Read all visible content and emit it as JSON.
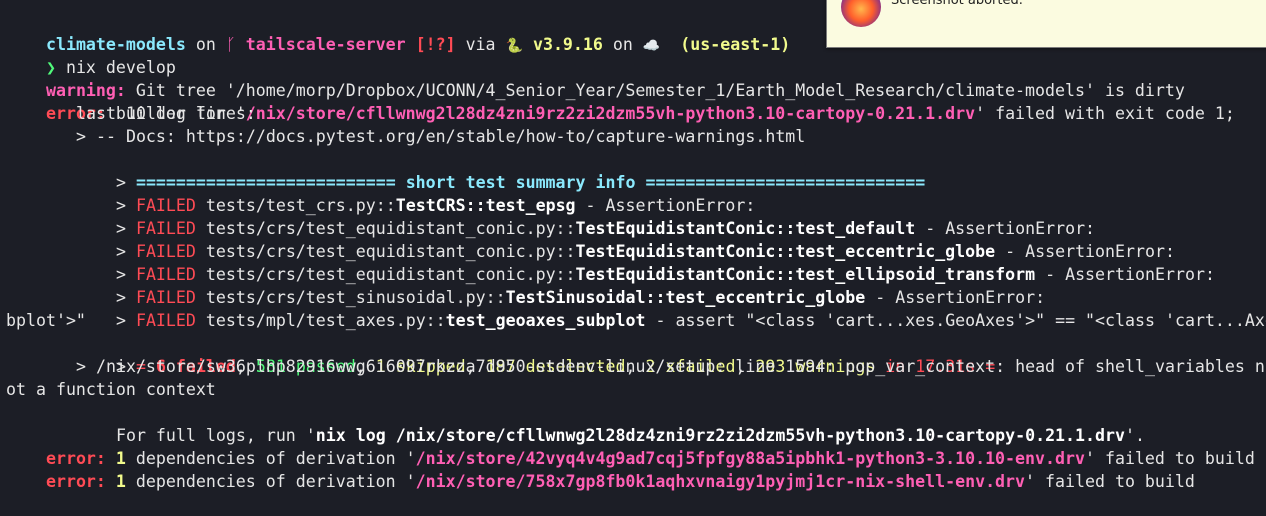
{
  "prompt": {
    "dir": "climate-models",
    "on1": " on ",
    "branch_icon": "ᚴ",
    "branch": " tailscale-server",
    "status": " [!?]",
    "via": " via ",
    "py_icon": "🐍",
    "py": " v3.9.16",
    "on2": " on ",
    "cloud_icon": "☁️",
    "region": "  (us-east-1)"
  },
  "command": {
    "arrow": "❯ ",
    "text": "nix develop"
  },
  "lines": {
    "warn_tag": "warning:",
    "warn_msg": " Git tree '/home/morp/Dropbox/UCONN/4_Senior_Year/Semester_1/Earth_Model_Research/climate-models' is dirty",
    "err1_tag": "error:",
    "err1_a": " builder for '",
    "err1_path": "/nix/store/cfllwnwg2l28dz4zni9rz2zi2dzm55vh-python3.10-cartopy-0.21.1.drv",
    "err1_b": "' failed with exit code 1;",
    "last10": "last 10 log lines:",
    "docs": "> -- Docs: https://docs.pytest.org/en/stable/how-to/capture-warnings.html",
    "summary_gt": "> ",
    "summary": "========================== short test summary info ============================",
    "gt": "> ",
    "failed": "FAILED",
    "f1_path": " tests/test_crs.py::",
    "f1_test": "TestCRS::test_epsg",
    "f1_err": " - AssertionError:",
    "f2_path": " tests/crs/test_equidistant_conic.py::",
    "f2_test": "TestEquidistantConic::test_default",
    "f2_err": " - AssertionError:",
    "f3_path": " tests/crs/test_equidistant_conic.py::",
    "f3_test": "TestEquidistantConic::test_eccentric_globe",
    "f3_err": " - AssertionError:",
    "f4_path": " tests/crs/test_equidistant_conic.py::",
    "f4_test": "TestEquidistantConic::test_ellipsoid_transform",
    "f4_err": " - AssertionError:",
    "f5_path": " tests/crs/test_sinusoidal.py::",
    "f5_test": "TestSinusoidal::test_eccentric_globe",
    "f5_err": " - AssertionError:",
    "f6_path": " tests/mpl/test_axes.py::",
    "f6_test": "test_geoaxes_subplot",
    "f6_err": " - assert \"<class 'cart...xes.GeoAxes'>\" == \"<class 'cart...AxesSu",
    "f6_wrap": "bplot'>\"",
    "res_open": "= ",
    "res_failed": "6 failed",
    "res_c1": ", ",
    "res_passed": "581 passed",
    "res_c2": ", ",
    "res_skipped": "1 skipped",
    "res_c3": ", ",
    "res_deselected": "187 deselected",
    "res_c4": ", ",
    "res_xfailed": "2 xfailed",
    "res_c5": ", ",
    "res_warnings": "293 warnings",
    "res_time": " in 17.31s =",
    "setup": "> /nix/store/sw36plhp82916wwg6i6097rkzza7d950-stdenv-linux/setup: line 1594: pop_var_context: head of shell_variables n",
    "setup_wrap": "ot a function context",
    "full_a": "For full logs, run '",
    "full_cmd": "nix log /nix/store/cfllwnwg2l28dz4zni9rz2zi2dzm55vh-python3.10-cartopy-0.21.1.drv",
    "full_b": "'.",
    "err2_tag": "error:",
    "err2_num": " 1",
    "err2_a": " dependencies of derivation '",
    "err2_path": "/nix/store/42vyq4v4g9ad7cqj5fpfgy88a5ipbhk1-python3-3.10.10-env.drv",
    "err2_b": "' failed to build",
    "err3_tag": "error:",
    "err3_num": " 1",
    "err3_a": " dependencies of derivation '",
    "err3_path": "/nix/store/758x7gp8fb0k1aqhxvnaigy1pyjmj1cr-nix-shell-env.drv",
    "err3_b": "' failed to build"
  },
  "notification": {
    "text": "Screenshot aborted."
  },
  "colors": {
    "background": "#1c1e26",
    "cyan": "#8be9fd",
    "pink": "#ff5fb4",
    "red": "#ff4b55",
    "yellow": "#f1fa8c",
    "green": "#50fa7b"
  }
}
